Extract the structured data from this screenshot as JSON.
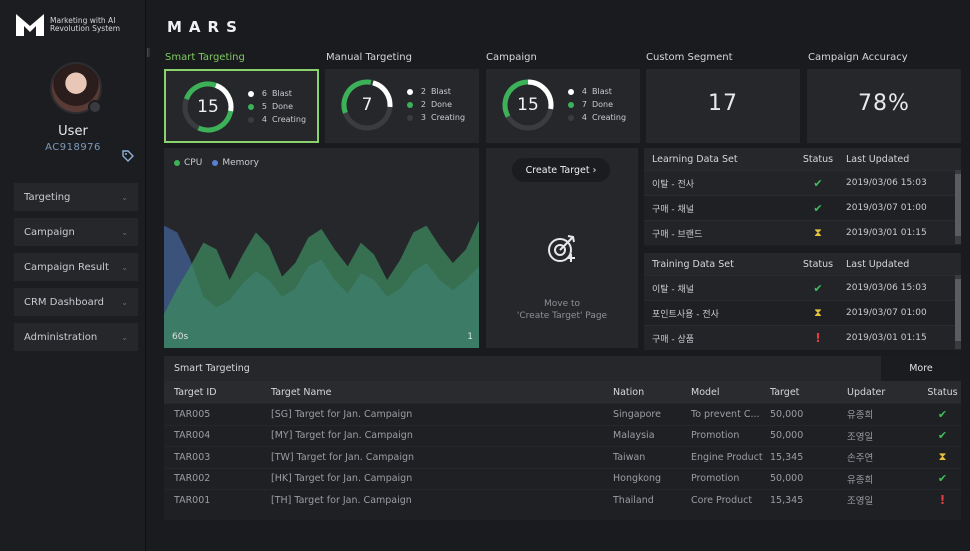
{
  "app": {
    "title": "MARS",
    "logo_line1": "Marketing with AI",
    "logo_line2": "Revolution System"
  },
  "user": {
    "name": "User",
    "id": "AC918976"
  },
  "menu": [
    {
      "label": "Targeting"
    },
    {
      "label": "Campaign"
    },
    {
      "label": "Campaign Result"
    },
    {
      "label": "CRM Dashboard"
    },
    {
      "label": "Administration"
    }
  ],
  "kpis": {
    "smart": {
      "label": "Smart Targeting",
      "total": "15",
      "rows": [
        {
          "n": "6",
          "label": "Blast"
        },
        {
          "n": "5",
          "label": "Done"
        },
        {
          "n": "4",
          "label": "Creating"
        }
      ]
    },
    "manual": {
      "label": "Manual Targeting",
      "total": "7",
      "rows": [
        {
          "n": "2",
          "label": "Blast"
        },
        {
          "n": "2",
          "label": "Done"
        },
        {
          "n": "3",
          "label": "Creating"
        }
      ]
    },
    "campaign": {
      "label": "Campaign",
      "total": "15",
      "rows": [
        {
          "n": "4",
          "label": "Blast"
        },
        {
          "n": "7",
          "label": "Done"
        },
        {
          "n": "4",
          "label": "Creating"
        }
      ]
    },
    "custom": {
      "label": "Custom Segment",
      "value": "17"
    },
    "accuracy": {
      "label": "Campaign Accuracy",
      "value": "78%"
    }
  },
  "chart": {
    "legend_cpu": "CPU",
    "legend_memory": "Memory",
    "foot_left": "60s",
    "foot_right": "1"
  },
  "chart_data": {
    "type": "area",
    "series": [
      {
        "name": "CPU",
        "color": "#3d8a5f",
        "values": [
          20,
          35,
          48,
          62,
          58,
          40,
          55,
          68,
          60,
          42,
          50,
          65,
          70,
          58,
          48,
          62,
          55,
          40,
          52,
          68,
          72,
          60,
          50,
          58,
          75
        ]
      },
      {
        "name": "Memory",
        "color": "#3f5b8a",
        "values": [
          72,
          68,
          52,
          30,
          24,
          28,
          38,
          45,
          40,
          30,
          35,
          48,
          52,
          40,
          32,
          44,
          40,
          30,
          35,
          45,
          50,
          40,
          34,
          40,
          48
        ]
      }
    ],
    "ylim": [
      0,
      100
    ]
  },
  "create_target": {
    "button": "Create Target",
    "caption_line1": "Move to",
    "caption_line2": "'Create Target' Page"
  },
  "learning": {
    "headers": [
      "Learning Data Set",
      "Status",
      "Last Updated"
    ],
    "rows": [
      {
        "name": "이탈 - 전사",
        "status": "ok",
        "date": "2019/03/06 15:03"
      },
      {
        "name": "구매 - 채널",
        "status": "ok",
        "date": "2019/03/07 01:00"
      },
      {
        "name": "구매 - 브랜드",
        "status": "wait",
        "date": "2019/03/01 01:15"
      }
    ]
  },
  "training": {
    "headers": [
      "Training Data Set",
      "Status",
      "Last Updated"
    ],
    "rows": [
      {
        "name": "이탈 - 채널",
        "status": "ok",
        "date": "2019/03/06 15:03"
      },
      {
        "name": "포인트사용 - 전사",
        "status": "wait",
        "date": "2019/03/07 01:00"
      },
      {
        "name": "구매 - 상품",
        "status": "err",
        "date": "2019/03/01 01:15"
      }
    ]
  },
  "targets": {
    "title": "Smart Targeting",
    "more": "More",
    "headers": [
      "Target ID",
      "Target Name",
      "Nation",
      "Model",
      "Target",
      "Updater",
      "Status"
    ],
    "rows": [
      {
        "id": "TAR005",
        "name": "[SG] Target for Jan. Campaign",
        "nation": "Singapore",
        "model": "To prevent C...",
        "target": "50,000",
        "updater": "유종희",
        "status": "ok"
      },
      {
        "id": "TAR004",
        "name": "[MY] Target for Jan. Campaign",
        "nation": "Malaysia",
        "model": "Promotion",
        "target": "50,000",
        "updater": "조영일",
        "status": "ok"
      },
      {
        "id": "TAR003",
        "name": "[TW] Target for Jan. Campaign",
        "nation": "Taiwan",
        "model": "Engine Product",
        "target": "15,345",
        "updater": "손주연",
        "status": "wait"
      },
      {
        "id": "TAR002",
        "name": "[HK] Target for Jan. Campaign",
        "nation": "Hongkong",
        "model": "Promotion",
        "target": "50,000",
        "updater": "유종희",
        "status": "ok"
      },
      {
        "id": "TAR001",
        "name": "[TH] Target for Jan. Campaign",
        "nation": "Thailand",
        "model": "Core Product",
        "target": "15,345",
        "updater": "조영일",
        "status": "err"
      }
    ]
  },
  "status_glyphs": {
    "ok": "✔",
    "wait": "⧗",
    "err": "!"
  },
  "colors": {
    "accent": "#8ad36a",
    "ring_green": "#3cb158",
    "ok": "#3fbf5a",
    "wait": "#e6c13b",
    "err": "#e24040"
  }
}
